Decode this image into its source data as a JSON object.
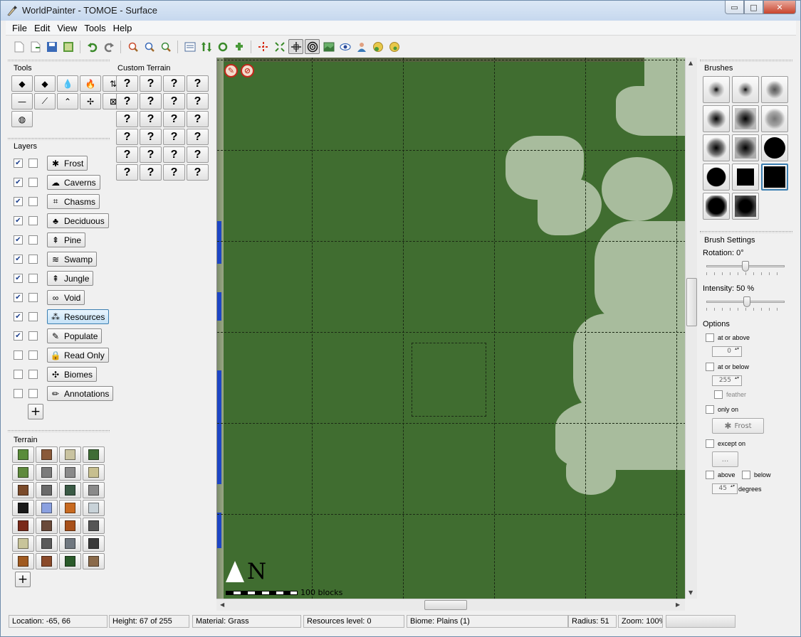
{
  "window": {
    "title": "WorldPainter - TOMOE - Surface",
    "minimize_glyph": "▭",
    "maximize_glyph": "□",
    "close_glyph": "✕"
  },
  "menu": [
    "File",
    "Edit",
    "View",
    "Tools",
    "Help"
  ],
  "toolbar": {
    "buttons": [
      "new-world-icon",
      "open-icon",
      "save-icon",
      "export-icon",
      "undo-icon",
      "redo-icon",
      "zoom-out-icon",
      "zoom-in-icon",
      "zoom-reset-icon",
      "dimension-properties-icon",
      "height-map-icon",
      "rotate-icon",
      "plugin-icon",
      "move-to-spawn-icon",
      "fit-icon",
      "grid-icon",
      "contours-icon",
      "image-overlay-icon",
      "view-icon",
      "third-person-icon",
      "globe-icon",
      "globe-alt-icon"
    ]
  },
  "tools": {
    "label": "Tools",
    "buttons": [
      "raise-tool",
      "lower-tool",
      "flood-tool",
      "lava-tool",
      "sponge-tool",
      "smooth-tool",
      "flatten-tool",
      "slope-tool",
      "pyramid-tool",
      "spray-tool",
      "text-tool",
      "global-tool"
    ],
    "glyphs": [
      "◆",
      "◆",
      "💧",
      "🔥",
      "⇅",
      "—",
      "⟋",
      "⌃",
      "✢",
      "⊠",
      "◍"
    ]
  },
  "custom_terrain": {
    "label": "Custom Terrain",
    "placeholder": "?"
  },
  "layers": {
    "label": "Layers",
    "items": [
      {
        "name": "Frost",
        "icon": "snowflake-icon",
        "glyph": "✱",
        "visible": true
      },
      {
        "name": "Caverns",
        "icon": "cavern-icon",
        "glyph": "☁",
        "visible": true
      },
      {
        "name": "Chasms",
        "icon": "chasm-icon",
        "glyph": "⌗",
        "visible": true
      },
      {
        "name": "Deciduous",
        "icon": "tree-icon",
        "glyph": "♣",
        "visible": true
      },
      {
        "name": "Pine",
        "icon": "pine-icon",
        "glyph": "⇞",
        "visible": true
      },
      {
        "name": "Swamp",
        "icon": "swamp-icon",
        "glyph": "≋",
        "visible": true
      },
      {
        "name": "Jungle",
        "icon": "jungle-icon",
        "glyph": "⇞",
        "visible": true
      },
      {
        "name": "Void",
        "icon": "infinity-icon",
        "glyph": "∞",
        "visible": true
      },
      {
        "name": "Resources",
        "icon": "resources-icon",
        "glyph": "⁂",
        "visible": true
      },
      {
        "name": "Populate",
        "icon": "populate-icon",
        "glyph": "✎",
        "visible": true
      },
      {
        "name": "Read Only",
        "icon": "lock-icon",
        "glyph": "🔒",
        "visible": false
      },
      {
        "name": "Biomes",
        "icon": "biomes-icon",
        "glyph": "✣",
        "visible": false
      },
      {
        "name": "Annotations",
        "icon": "pen-icon",
        "glyph": "✏",
        "visible": false
      }
    ],
    "add_glyph": "+"
  },
  "terrain": {
    "label": "Terrain",
    "add_glyph": "+",
    "swatches": [
      "#5a8c3a",
      "#8a5a3a",
      "#c9c3a0",
      "#3f6d36",
      "#5f8a3d",
      "#7c7c7c",
      "#8a8a8a",
      "#c7bf8f",
      "#7a4a2a",
      "#6a6a6a",
      "#3a5a45",
      "#8a8a8a",
      "#1a1a1a",
      "#8aa0e0",
      "#c86a20",
      "#c8d2d8",
      "#7a2a1a",
      "#6a4a3a",
      "#a8501a",
      "#555555",
      "#c8c49a",
      "#5a5a5a",
      "#707880",
      "#3a3a3a",
      "#a05a20",
      "#8a4a2a",
      "#2a5a2a",
      "#8a6a4a"
    ]
  },
  "map": {
    "scale_label": "100 blocks",
    "north_label": "N",
    "overlay_glyph_a": "✎",
    "overlay_glyph_b": "⊘"
  },
  "brushes": {
    "label": "Brushes"
  },
  "brush_settings": {
    "label": "Brush Settings",
    "rotation_label": "Rotation: 0°",
    "rotation_value": 0,
    "intensity_label": "Intensity: 50 %",
    "intensity_value": 50,
    "options_label": "Options",
    "at_or_above": "at or above",
    "at_or_above_value": "0",
    "at_or_below": "at or below",
    "at_or_below_value": "255",
    "feather": "feather",
    "only_on": "only on",
    "only_on_button": "Frost",
    "except_on": "except on",
    "except_on_button": "...",
    "above": "above",
    "below": "below",
    "degrees_value": "45",
    "degrees_label": "degrees"
  },
  "status": {
    "location": "Location: -65, 66",
    "height": "Height: 67 of 255",
    "material": "Material: Grass",
    "resources": "Resources level: 0",
    "biome": "Biome: Plains (1)",
    "radius": "Radius: 51",
    "zoom": "Zoom: 100%"
  },
  "colors": {
    "map_grass": "#406d30",
    "snow": "#a8bc9d",
    "accent": "#3c7fb1"
  }
}
